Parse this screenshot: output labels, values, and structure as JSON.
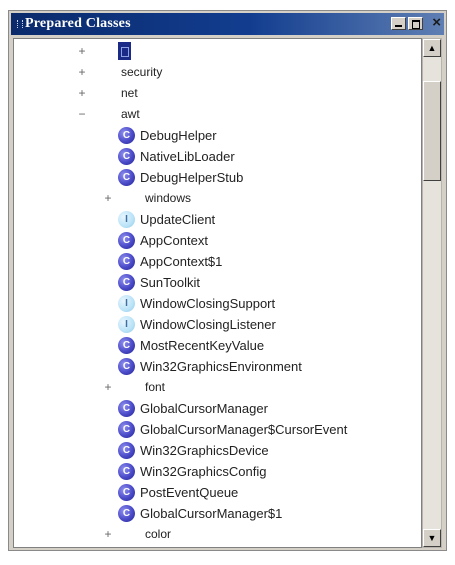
{
  "window": {
    "title": "Prepared Classes",
    "close_glyph": "×"
  },
  "tree": [
    {
      "label": "",
      "kind": "package",
      "expander": "+",
      "depth": 0,
      "selected": true
    },
    {
      "label": "security",
      "kind": "package",
      "expander": "+",
      "depth": 0
    },
    {
      "label": "net",
      "kind": "package",
      "expander": "+",
      "depth": 0
    },
    {
      "label": "awt",
      "kind": "package",
      "expander": "−",
      "depth": 0
    },
    {
      "label": "DebugHelper",
      "kind": "class",
      "depth": 1
    },
    {
      "label": "NativeLibLoader",
      "kind": "class",
      "depth": 1
    },
    {
      "label": "DebugHelperStub",
      "kind": "class",
      "depth": 1
    },
    {
      "label": "windows",
      "kind": "package",
      "expander": "+",
      "depth": 1
    },
    {
      "label": "UpdateClient",
      "kind": "interface",
      "depth": 1
    },
    {
      "label": "AppContext",
      "kind": "class",
      "depth": 1
    },
    {
      "label": "AppContext$1",
      "kind": "class",
      "depth": 1
    },
    {
      "label": "SunToolkit",
      "kind": "class",
      "depth": 1
    },
    {
      "label": "WindowClosingSupport",
      "kind": "interface",
      "depth": 1
    },
    {
      "label": "WindowClosingListener",
      "kind": "interface",
      "depth": 1
    },
    {
      "label": "MostRecentKeyValue",
      "kind": "class",
      "depth": 1
    },
    {
      "label": "Win32GraphicsEnvironment",
      "kind": "class",
      "depth": 1
    },
    {
      "label": "font",
      "kind": "package",
      "expander": "+",
      "depth": 1
    },
    {
      "label": "GlobalCursorManager",
      "kind": "class",
      "depth": 1
    },
    {
      "label": "GlobalCursorManager$CursorEvent",
      "kind": "class",
      "depth": 1
    },
    {
      "label": "Win32GraphicsDevice",
      "kind": "class",
      "depth": 1
    },
    {
      "label": "Win32GraphicsConfig",
      "kind": "class",
      "depth": 1
    },
    {
      "label": "PostEventQueue",
      "kind": "class",
      "depth": 1
    },
    {
      "label": "GlobalCursorManager$1",
      "kind": "class",
      "depth": 1
    },
    {
      "label": "color",
      "kind": "package",
      "expander": "+",
      "depth": 1
    }
  ],
  "icons": {
    "class": "class-icon",
    "interface": "interface-icon",
    "class_glyph": "C",
    "interface_glyph": "I"
  },
  "scrollbar": {
    "up_glyph": "▲",
    "down_glyph": "▼"
  },
  "colors": {
    "titlebar": "#0a2a6b",
    "class_icon": "#4a4ac8",
    "interface_icon": "#b9e2f7",
    "selection": "#1a2a86"
  }
}
